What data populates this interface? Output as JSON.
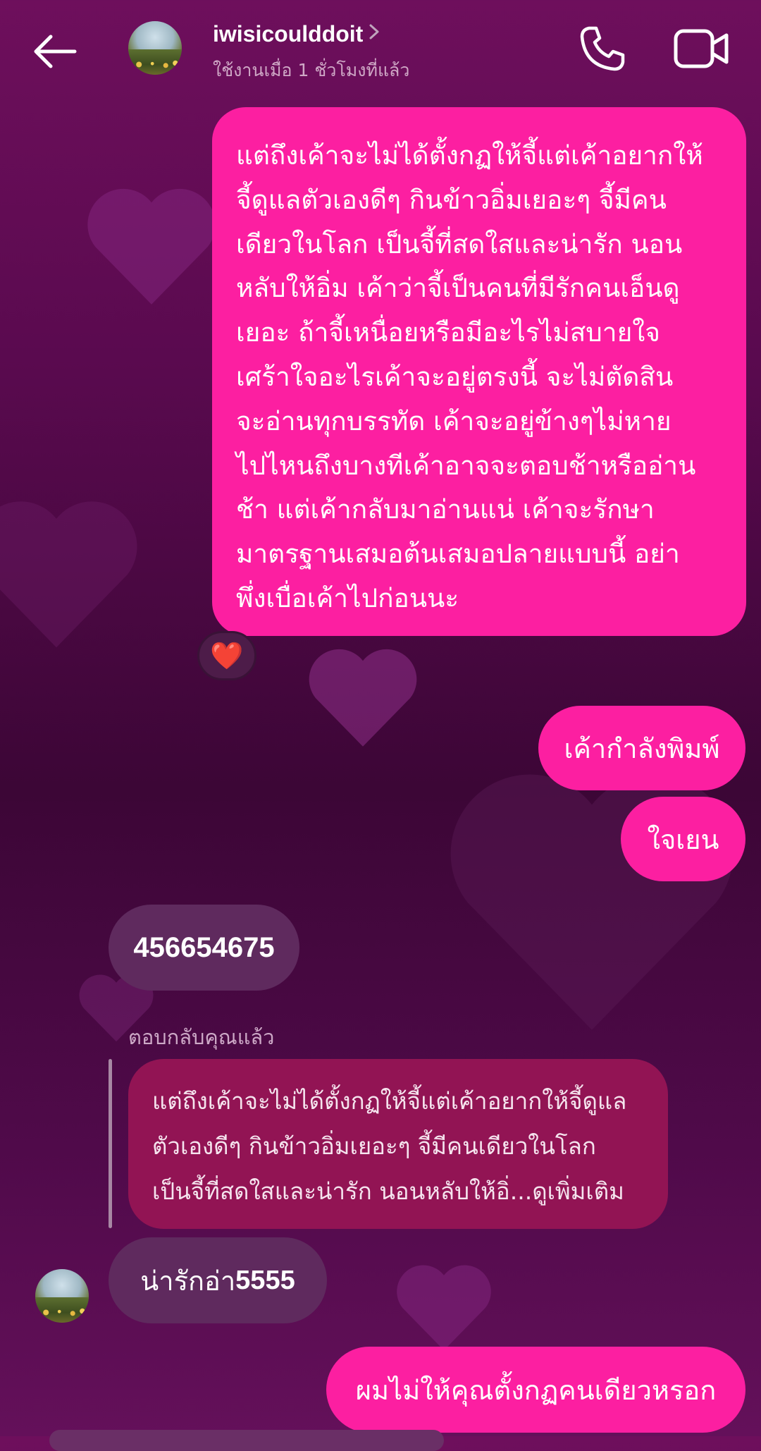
{
  "header": {
    "username": "iwisicoulddoit",
    "status": "ใช้งานเมื่อ 1 ชั่วโมงที่แล้ว",
    "back_icon": "arrow-left-icon",
    "call_icon": "phone-icon",
    "video_icon": "video-camera-icon"
  },
  "messages": {
    "long_sent": "แต่ถึงเค้าจะไม่ได้ตั้งกฏให้จี้แต่เค้าอยากให้\nจี้ดูแลตัวเองดีๆ กินข้าวอิ่มเยอะๆ จี้มีคน\nเดียวในโลก เป็นจี้ที่สดใสและน่ารัก นอน\nหลับให้อิ่ม เค้าว่าจี้เป็นคนที่มีรักคนเอ็นดู\nเยอะ ถ้าจี้เหนื่อยหรือมีอะไรไม่สบายใจ\nเศร้าใจอะไรเค้าจะอยู่ตรงนี้ จะไม่ตัดสิน\nจะอ่านทุกบรรทัด เค้าจะอยู่ข้างๆไม่หาย\nไปไหนถึงบางทีเค้าอาจจะตอบช้าหรืออ่าน\nช้า แต่เค้ากลับมาอ่านแน่ เค้าจะรักษา\nมาตรฐานเสมอต้นเสมอปลายแบบนี้ อย่า\nพึ่งเบื่อเค้าไปก่อนนะ",
    "reaction_emoji": "❤️",
    "typing": "เค้ากำลังพิมพ์",
    "calm": "ใจเยน",
    "number": "456654675",
    "reply_label": "ตอบกลับคุณแล้ว",
    "reply_quote": "แต่ถึงเค้าจะไม่ได้ตั้งกฏให้จี้แต่เค้าอยากให้จี้ดูแล\nตัวเองดีๆ กินข้าวอิ่มเยอะๆ จี้มีคนเดียวในโลก\nเป็นจี้ที่สดใสและน่ารัก นอนหลับให้อิ่...ดูเพิ่มเติม",
    "cute_text": "น่ารักอ่า",
    "cute_num": "5555",
    "last_sent": "ผมไม่ให้คุณตั้งกฏคนเดียวหรอก"
  },
  "colors": {
    "sent_bubble": "#fc1fa1",
    "received_bubble": "#5f2a5e",
    "quote_bubble": "#921454"
  }
}
